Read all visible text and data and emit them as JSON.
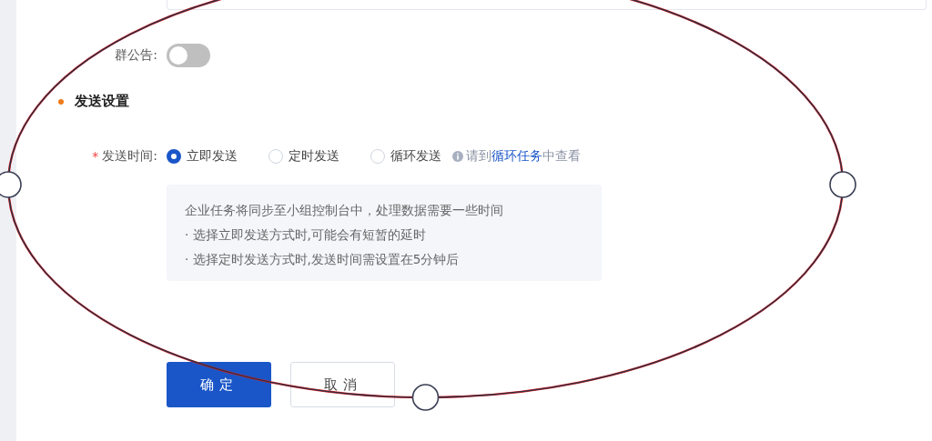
{
  "announcement": {
    "label": "群公告:",
    "on": false
  },
  "section": {
    "title": "发送设置"
  },
  "send_time": {
    "label": "发送时间:",
    "required_mark": "*",
    "options": [
      {
        "label": "立即发送",
        "selected": true
      },
      {
        "label": "定时发送",
        "selected": false
      },
      {
        "label": "循环发送",
        "selected": false
      }
    ],
    "hint": {
      "before": "请到",
      "link": "循环任务",
      "after": "中查看"
    }
  },
  "notice": [
    "企业任务将同步至小组控制台中，处理数据需要一些时间",
    "· 选择立即发送方式时,可能会有短暂的延时",
    "· 选择定时发送方式时,发送时间需设置在5分钟后"
  ],
  "buttons": [
    {
      "label": "确定",
      "kind": "primary"
    },
    {
      "label": "取消",
      "kind": "default"
    }
  ]
}
